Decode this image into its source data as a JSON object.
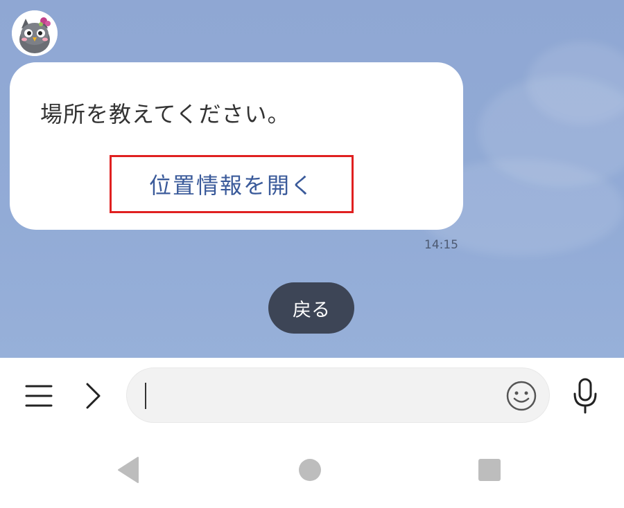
{
  "message": {
    "text": "場所を教えてください。",
    "action_label": "位置情報を開く",
    "time": "14:15"
  },
  "quick_reply": {
    "back_label": "戻る"
  },
  "input": {
    "value": ""
  },
  "icons": {
    "menu": "hamburger-menu-icon",
    "expand": "chevron-right-icon",
    "emoji": "smiley-icon",
    "mic": "microphone-icon",
    "nav_back": "triangle-back-icon",
    "nav_home": "circle-home-icon",
    "nav_recent": "square-recent-icon"
  },
  "colors": {
    "chat_background": "#92abd6",
    "action_link": "#3a5a9a",
    "highlight_box": "#e02020",
    "back_pill": "#3d4556"
  }
}
